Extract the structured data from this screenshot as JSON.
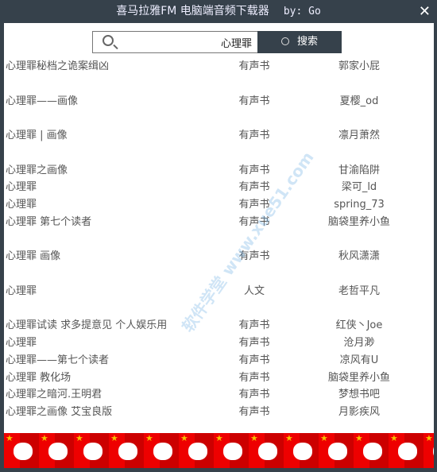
{
  "window": {
    "title": "喜马拉雅FM 电脑端音频下载器",
    "author": "by: Go",
    "close": "✕"
  },
  "search": {
    "value": "心理罪",
    "button": "搜索"
  },
  "watermark": "软件学堂 www.xue51.com",
  "rows": [
    {
      "title": "心理罪秘档之诡案缉凶",
      "type": "有声书",
      "author": "郭家小屁"
    },
    {},
    {
      "title": "心理罪——画像",
      "type": "有声书",
      "author": "夏樱_od"
    },
    {},
    {
      "title": "心理罪 | 画像",
      "type": "有声书",
      "author": "凛月萧然"
    },
    {},
    {
      "title": "心理罪之画像",
      "type": "有声书",
      "author": "甘渝陷阱"
    },
    {
      "title": "心理罪",
      "type": "有声书",
      "author": "梁可_ld"
    },
    {
      "title": "心理罪",
      "type": "有声书",
      "author": "spring_73"
    },
    {
      "title": "心理罪 第七个读者",
      "type": "有声书",
      "author": "脑袋里养小鱼"
    },
    {},
    {
      "title": "心理罪 画像",
      "type": "有声书",
      "author": "秋风潇潇"
    },
    {},
    {
      "title": "心理罪",
      "type": "人文",
      "author": "老哲平凡"
    },
    {},
    {
      "title": "心理罪试读 求多提意见 个人娱乐用",
      "type": "有声书",
      "author": "红侠丶Joe"
    },
    {
      "title": "心理罪",
      "type": "有声书",
      "author": "沧月渺"
    },
    {
      "title": "心理罪——第七个读者",
      "type": "有声书",
      "author": "凉风有U"
    },
    {
      "title": "心理罪 教化场",
      "type": "有声书",
      "author": "脑袋里养小鱼"
    },
    {
      "title": "心理罪之暗河.王明君",
      "type": "有声书",
      "author": "梦想书吧"
    },
    {
      "title": "心理罪之画像 艾宝良版",
      "type": "有声书",
      "author": "月影疾风"
    }
  ]
}
